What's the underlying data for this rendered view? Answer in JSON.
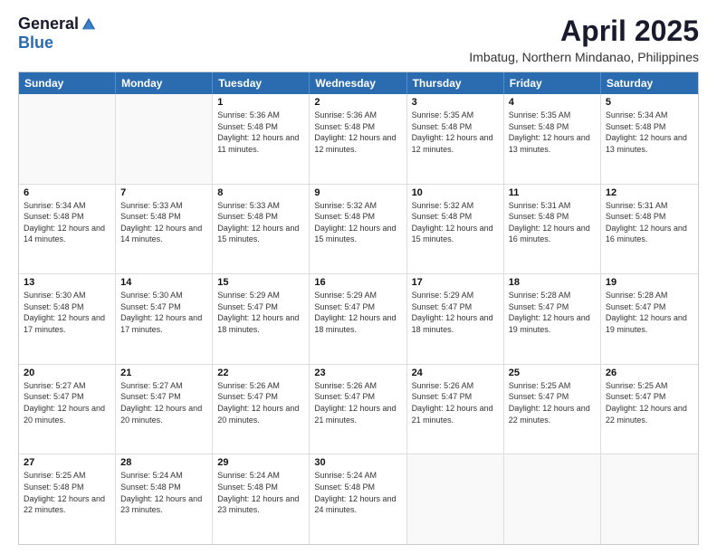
{
  "logo": {
    "general": "General",
    "blue": "Blue"
  },
  "title": {
    "month_year": "April 2025",
    "location": "Imbatug, Northern Mindanao, Philippines"
  },
  "days_of_week": [
    "Sunday",
    "Monday",
    "Tuesday",
    "Wednesday",
    "Thursday",
    "Friday",
    "Saturday"
  ],
  "weeks": [
    [
      {
        "day": "",
        "text": ""
      },
      {
        "day": "",
        "text": ""
      },
      {
        "day": "1",
        "text": "Sunrise: 5:36 AM\nSunset: 5:48 PM\nDaylight: 12 hours and 11 minutes."
      },
      {
        "day": "2",
        "text": "Sunrise: 5:36 AM\nSunset: 5:48 PM\nDaylight: 12 hours and 12 minutes."
      },
      {
        "day": "3",
        "text": "Sunrise: 5:35 AM\nSunset: 5:48 PM\nDaylight: 12 hours and 12 minutes."
      },
      {
        "day": "4",
        "text": "Sunrise: 5:35 AM\nSunset: 5:48 PM\nDaylight: 12 hours and 13 minutes."
      },
      {
        "day": "5",
        "text": "Sunrise: 5:34 AM\nSunset: 5:48 PM\nDaylight: 12 hours and 13 minutes."
      }
    ],
    [
      {
        "day": "6",
        "text": "Sunrise: 5:34 AM\nSunset: 5:48 PM\nDaylight: 12 hours and 14 minutes."
      },
      {
        "day": "7",
        "text": "Sunrise: 5:33 AM\nSunset: 5:48 PM\nDaylight: 12 hours and 14 minutes."
      },
      {
        "day": "8",
        "text": "Sunrise: 5:33 AM\nSunset: 5:48 PM\nDaylight: 12 hours and 15 minutes."
      },
      {
        "day": "9",
        "text": "Sunrise: 5:32 AM\nSunset: 5:48 PM\nDaylight: 12 hours and 15 minutes."
      },
      {
        "day": "10",
        "text": "Sunrise: 5:32 AM\nSunset: 5:48 PM\nDaylight: 12 hours and 15 minutes."
      },
      {
        "day": "11",
        "text": "Sunrise: 5:31 AM\nSunset: 5:48 PM\nDaylight: 12 hours and 16 minutes."
      },
      {
        "day": "12",
        "text": "Sunrise: 5:31 AM\nSunset: 5:48 PM\nDaylight: 12 hours and 16 minutes."
      }
    ],
    [
      {
        "day": "13",
        "text": "Sunrise: 5:30 AM\nSunset: 5:48 PM\nDaylight: 12 hours and 17 minutes."
      },
      {
        "day": "14",
        "text": "Sunrise: 5:30 AM\nSunset: 5:47 PM\nDaylight: 12 hours and 17 minutes."
      },
      {
        "day": "15",
        "text": "Sunrise: 5:29 AM\nSunset: 5:47 PM\nDaylight: 12 hours and 18 minutes."
      },
      {
        "day": "16",
        "text": "Sunrise: 5:29 AM\nSunset: 5:47 PM\nDaylight: 12 hours and 18 minutes."
      },
      {
        "day": "17",
        "text": "Sunrise: 5:29 AM\nSunset: 5:47 PM\nDaylight: 12 hours and 18 minutes."
      },
      {
        "day": "18",
        "text": "Sunrise: 5:28 AM\nSunset: 5:47 PM\nDaylight: 12 hours and 19 minutes."
      },
      {
        "day": "19",
        "text": "Sunrise: 5:28 AM\nSunset: 5:47 PM\nDaylight: 12 hours and 19 minutes."
      }
    ],
    [
      {
        "day": "20",
        "text": "Sunrise: 5:27 AM\nSunset: 5:47 PM\nDaylight: 12 hours and 20 minutes."
      },
      {
        "day": "21",
        "text": "Sunrise: 5:27 AM\nSunset: 5:47 PM\nDaylight: 12 hours and 20 minutes."
      },
      {
        "day": "22",
        "text": "Sunrise: 5:26 AM\nSunset: 5:47 PM\nDaylight: 12 hours and 20 minutes."
      },
      {
        "day": "23",
        "text": "Sunrise: 5:26 AM\nSunset: 5:47 PM\nDaylight: 12 hours and 21 minutes."
      },
      {
        "day": "24",
        "text": "Sunrise: 5:26 AM\nSunset: 5:47 PM\nDaylight: 12 hours and 21 minutes."
      },
      {
        "day": "25",
        "text": "Sunrise: 5:25 AM\nSunset: 5:47 PM\nDaylight: 12 hours and 22 minutes."
      },
      {
        "day": "26",
        "text": "Sunrise: 5:25 AM\nSunset: 5:47 PM\nDaylight: 12 hours and 22 minutes."
      }
    ],
    [
      {
        "day": "27",
        "text": "Sunrise: 5:25 AM\nSunset: 5:48 PM\nDaylight: 12 hours and 22 minutes."
      },
      {
        "day": "28",
        "text": "Sunrise: 5:24 AM\nSunset: 5:48 PM\nDaylight: 12 hours and 23 minutes."
      },
      {
        "day": "29",
        "text": "Sunrise: 5:24 AM\nSunset: 5:48 PM\nDaylight: 12 hours and 23 minutes."
      },
      {
        "day": "30",
        "text": "Sunrise: 5:24 AM\nSunset: 5:48 PM\nDaylight: 12 hours and 24 minutes."
      },
      {
        "day": "",
        "text": ""
      },
      {
        "day": "",
        "text": ""
      },
      {
        "day": "",
        "text": ""
      }
    ]
  ]
}
